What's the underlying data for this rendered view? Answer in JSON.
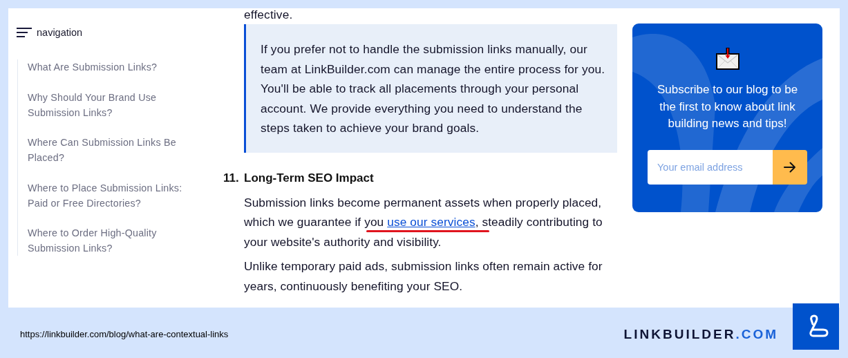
{
  "sidebar": {
    "title": "navigation",
    "items": [
      {
        "label": "What Are Submission Links?"
      },
      {
        "label": "Why Should Your Brand Use Submission Links?"
      },
      {
        "label": "Where Can Submission Links Be Placed?"
      },
      {
        "label": "Where to Place Submission Links: Paid or Free Directories?"
      },
      {
        "label": "Where to Order High-Quality Submission Links?"
      }
    ]
  },
  "article": {
    "intro_tail": "effective.",
    "callout": "If you prefer not to handle the submission links manually, our team at LinkBuilder.com can manage the entire process for you. You'll be able to track all placements through your personal account. We provide everything you need to understand the steps taken to achieve your brand goals.",
    "section": {
      "number": "11.",
      "heading": "Long-Term SEO Impact"
    },
    "paragraphs": [
      {
        "kind": "linked",
        "before": "Submission links become permanent assets when properly placed, which we guarantee if you ",
        "link": "use our services",
        "after": ", steadily contributing to your website's authority and visibility.",
        "marked": true
      },
      {
        "kind": "plain",
        "text": "Unlike temporary paid ads, submission links often remain active for years, continuously benefiting your SEO."
      }
    ]
  },
  "subscribe": {
    "text": "Subscribe to our blog to be the first to know about link building news and tips!",
    "placeholder": "Your email address"
  },
  "footer": {
    "url": "https://linkbuilder.com/blog/what-are-contextual-links",
    "brand": "LINKBUILDER",
    "brand_suffix": ".COM"
  }
}
